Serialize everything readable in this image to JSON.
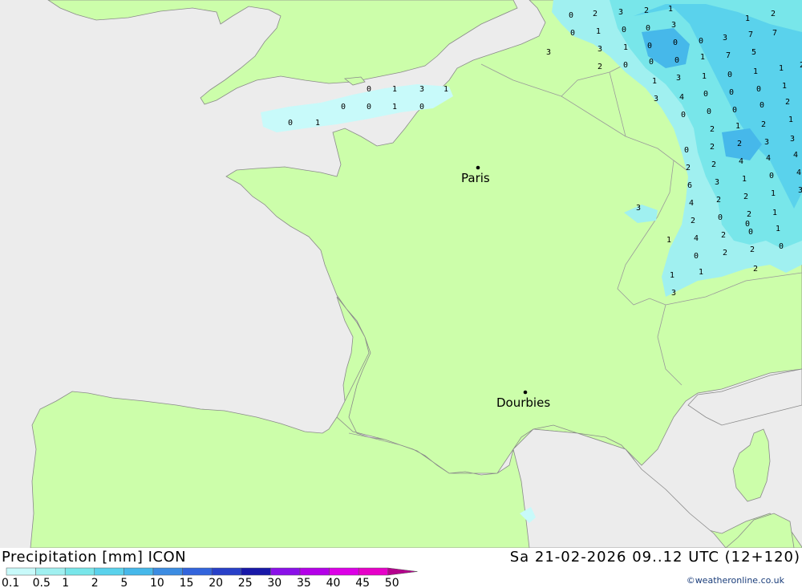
{
  "title": "Precipitation [mm] ICON",
  "time": "Sa 21-02-2026 09..12 UTC (12+120)",
  "credit": "©weatheronline.co.uk",
  "colors": {
    "sea": "#ececec",
    "land": "#ccfeaa",
    "border": "#9a9a9a",
    "coast": "#8a8a8a"
  },
  "legend": {
    "labels": [
      "0.1",
      "0.5",
      "1",
      "2",
      "5",
      "10",
      "15",
      "20",
      "25",
      "30",
      "35",
      "40",
      "45",
      "50"
    ],
    "colors": [
      "#c8fafa",
      "#a0f0f0",
      "#78e6ea",
      "#5ad2ec",
      "#46b8ea",
      "#3c8ce2",
      "#3264dc",
      "#2840c8",
      "#1818a8",
      "#8a10e8",
      "#b400e8",
      "#dc00e6",
      "#e600c8",
      "#b4008c"
    ]
  },
  "cities": [
    {
      "name": "Paris"
    },
    {
      "name": "Dourbies"
    }
  ],
  "precip_values": [
    "0",
    "2",
    "3",
    "2",
    "1",
    "0",
    "1",
    "0",
    "0",
    "3",
    "3",
    "3",
    "1",
    "0",
    "0",
    "0",
    "3",
    "7",
    "7",
    "2",
    "0",
    "0",
    "0",
    "1",
    "7",
    "5",
    "2",
    "1",
    "1",
    "3",
    "1",
    "0",
    "1",
    "1",
    "2",
    "3",
    "4",
    "0",
    "0",
    "0",
    "1",
    "0",
    "0",
    "0",
    "0",
    "2",
    "2",
    "1",
    "2",
    "1",
    "0",
    "2",
    "2",
    "3",
    "3",
    "2",
    "2",
    "4",
    "4",
    "4",
    "6",
    "3",
    "1",
    "0",
    "4",
    "4",
    "2",
    "2",
    "1",
    "3",
    "2",
    "0",
    "2",
    "1",
    "3",
    "1",
    "4",
    "2",
    "0",
    "1",
    "0",
    "2",
    "2",
    "0",
    "1",
    "1",
    "2",
    "3",
    "0",
    "1",
    "3",
    "1",
    "0",
    "0",
    "1",
    "0",
    "0",
    "1",
    "0"
  ]
}
